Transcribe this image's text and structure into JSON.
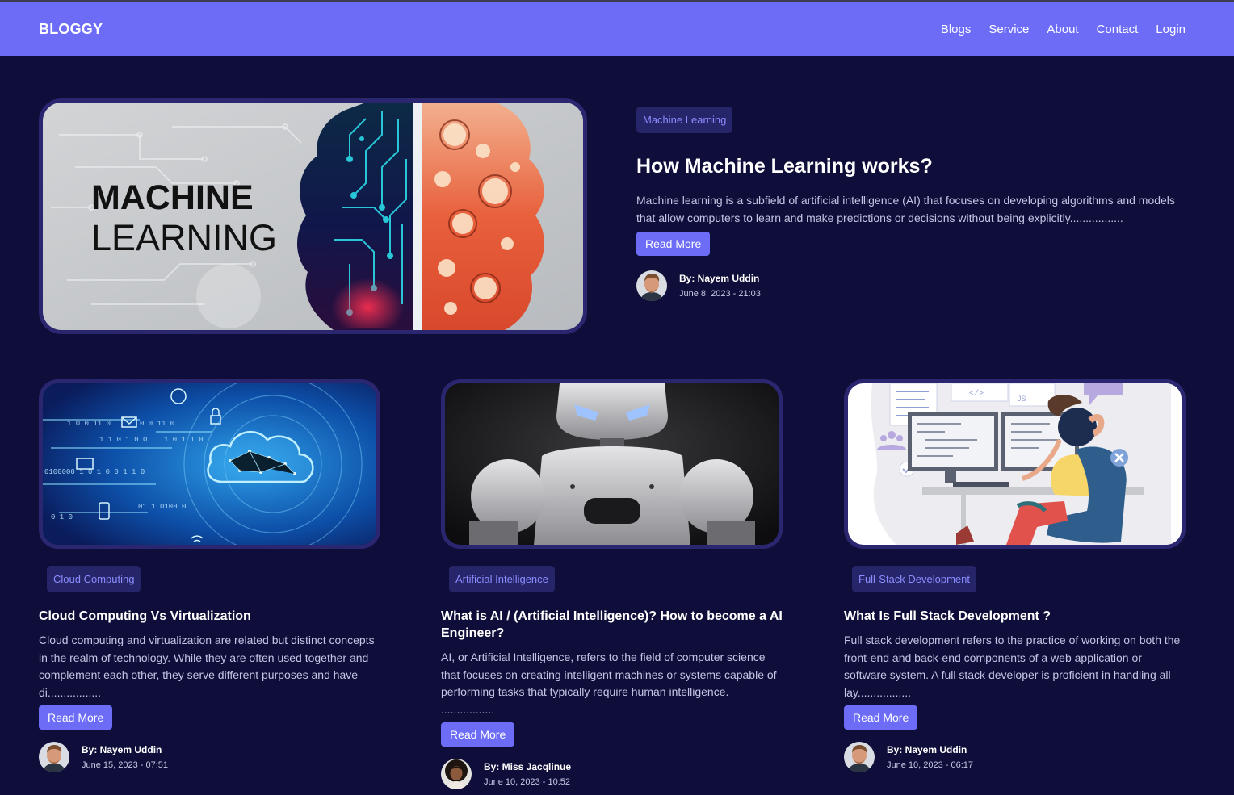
{
  "nav": {
    "brand": "BLOGGY",
    "links": [
      "Blogs",
      "Service",
      "About",
      "Contact",
      "Login"
    ]
  },
  "hero": {
    "image_text_line1": "MACHINE",
    "image_text_line2": "LEARNING",
    "tag": "Machine Learning",
    "title": "How Machine Learning works?",
    "excerpt": "Machine learning is a subfield of artificial intelligence (AI) that focuses on developing algorithms and models that allow computers to learn and make predictions or decisions without being explicitly.................",
    "button": "Read More",
    "author": "By: Nayem Uddin",
    "date": "June 8, 2023 - 21:03"
  },
  "posts": [
    {
      "tag": "Cloud Computing",
      "title": "Cloud Computing Vs Virtualization",
      "excerpt": "Cloud computing and virtualization are related but distinct concepts in the realm of technology. While they are often used together and complement each other, they serve different purposes and have di.................",
      "button": "Read More",
      "author": "By: Nayem Uddin",
      "date": "June 15, 2023 - 07:51"
    },
    {
      "tag": "Artificial Intelligence",
      "title": "What is AI / (Artificial Intelligence)? How to become a AI Engineer?",
      "excerpt": "AI, or Artificial Intelligence, refers to the field of computer science that focuses on creating intelligent machines or systems capable of performing tasks that typically require human intelligence. .................",
      "button": "Read More",
      "author": "By: Miss Jacqlinue",
      "date": "June 10, 2023 - 10:52"
    },
    {
      "tag": "Full-Stack Development",
      "title": "What Is Full Stack Development ?",
      "excerpt": "Full stack development refers to the practice of working on both the front-end and back-end components of a web application or software system. A full stack developer is proficient in handling all lay.................",
      "button": "Read More",
      "author": "By: Nayem Uddin",
      "date": "June 10, 2023 - 06:17"
    }
  ],
  "image_text": {
    "cloud_binary": [
      "1 0 0 11 0",
      "0100000 1 0 1 0 0 1 1 0",
      "0 1 0",
      "1 1 0 1 0 0",
      "0 0 11 0",
      "01 1 0100 0",
      "1 0 1 1 0"
    ],
    "code_tag": "</>",
    "js_label": "JS"
  },
  "colors": {
    "background": "#0f0e3a",
    "navbar": "#6c6cf7",
    "tag_bg": "#27256a",
    "tag_text": "#8c8cff",
    "button": "#6c6cf7",
    "image_border": "#2a2670"
  }
}
